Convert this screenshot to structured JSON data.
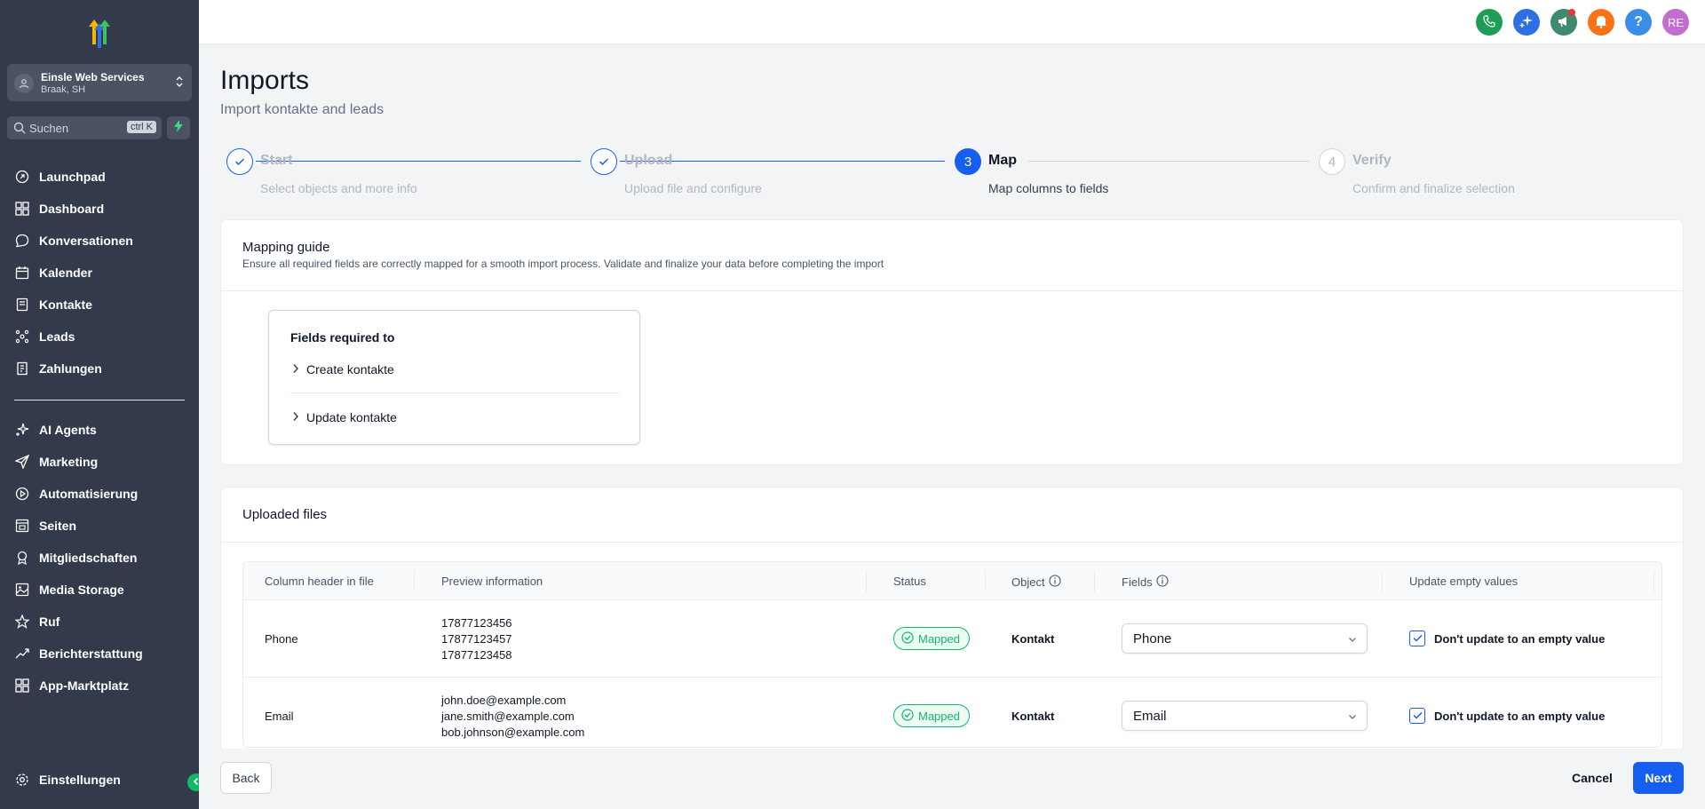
{
  "sidebar": {
    "account": {
      "name": "Einsle Web Services",
      "location": "Braak, SH"
    },
    "search": {
      "placeholder": "Suchen",
      "shortcut": "ctrl K"
    },
    "nav_primary": [
      {
        "label": "Launchpad",
        "icon": "rocket-icon"
      },
      {
        "label": "Dashboard",
        "icon": "grid-icon"
      },
      {
        "label": "Konversationen",
        "icon": "chat-icon"
      },
      {
        "label": "Kalender",
        "icon": "calendar-icon"
      },
      {
        "label": "Kontakte",
        "icon": "contacts-icon"
      },
      {
        "label": "Leads",
        "icon": "network-icon"
      },
      {
        "label": "Zahlungen",
        "icon": "receipt-icon"
      }
    ],
    "nav_secondary": [
      {
        "label": "AI Agents",
        "icon": "sparkle-icon"
      },
      {
        "label": "Marketing",
        "icon": "send-icon"
      },
      {
        "label": "Automatisierung",
        "icon": "automation-icon"
      },
      {
        "label": "Seiten",
        "icon": "pages-icon"
      },
      {
        "label": "Mitgliedschaften",
        "icon": "membership-icon"
      },
      {
        "label": "Media Storage",
        "icon": "image-icon"
      },
      {
        "label": "Ruf",
        "icon": "star-icon"
      },
      {
        "label": "Berichterstattung",
        "icon": "trend-icon"
      },
      {
        "label": "App-Marktplatz",
        "icon": "apps-icon"
      }
    ],
    "settings_label": "Einstellungen"
  },
  "topbar": {
    "avatar_initials": "RE",
    "help_glyph": "?",
    "colors": {
      "phone": "#1f9d55",
      "ai": "#2f6fe4",
      "announce": "#3f8a6f",
      "bell": "#f97316",
      "help": "#3b8ee8",
      "avatar": "#c06fd1"
    }
  },
  "page": {
    "title": "Imports",
    "subtitle": "Import kontakte and leads"
  },
  "stepper": [
    {
      "num": "",
      "title": "Start",
      "desc": "Select objects and more info",
      "state": "done"
    },
    {
      "num": "",
      "title": "Upload",
      "desc": "Upload file and configure",
      "state": "done"
    },
    {
      "num": "3",
      "title": "Map",
      "desc": "Map columns to fields",
      "state": "active"
    },
    {
      "num": "4",
      "title": "Verify",
      "desc": "Confirm and finalize selection",
      "state": "pending"
    }
  ],
  "mapping_guide": {
    "title": "Mapping guide",
    "desc": "Ensure all required fields are correctly mapped for a smooth import process. Validate and finalize your data before completing the import",
    "required_title": "Fields required to",
    "items": [
      "Create kontakte",
      "Update kontakte"
    ]
  },
  "uploaded": {
    "title": "Uploaded files",
    "columns": [
      "Column header in file",
      "Preview information",
      "Status",
      "Object",
      "Fields",
      "Update empty values"
    ],
    "rows": [
      {
        "header": "Phone",
        "preview": [
          "17877123456",
          "17877123457",
          "17877123458"
        ],
        "status": "Mapped",
        "object": "Kontakt",
        "field": "Phone",
        "update_label": "Don't update to an empty value"
      },
      {
        "header": "Email",
        "preview": [
          "john.doe@example.com",
          "jane.smith@example.com",
          "bob.johnson@example.com"
        ],
        "status": "Mapped",
        "object": "Kontakt",
        "field": "Email",
        "update_label": "Don't update to an empty value"
      }
    ]
  },
  "footer": {
    "back": "Back",
    "cancel": "Cancel",
    "next": "Next"
  },
  "colors": {
    "primary": "#155eef",
    "success": "#12b76a",
    "sidebar_bg": "#323a4b"
  }
}
